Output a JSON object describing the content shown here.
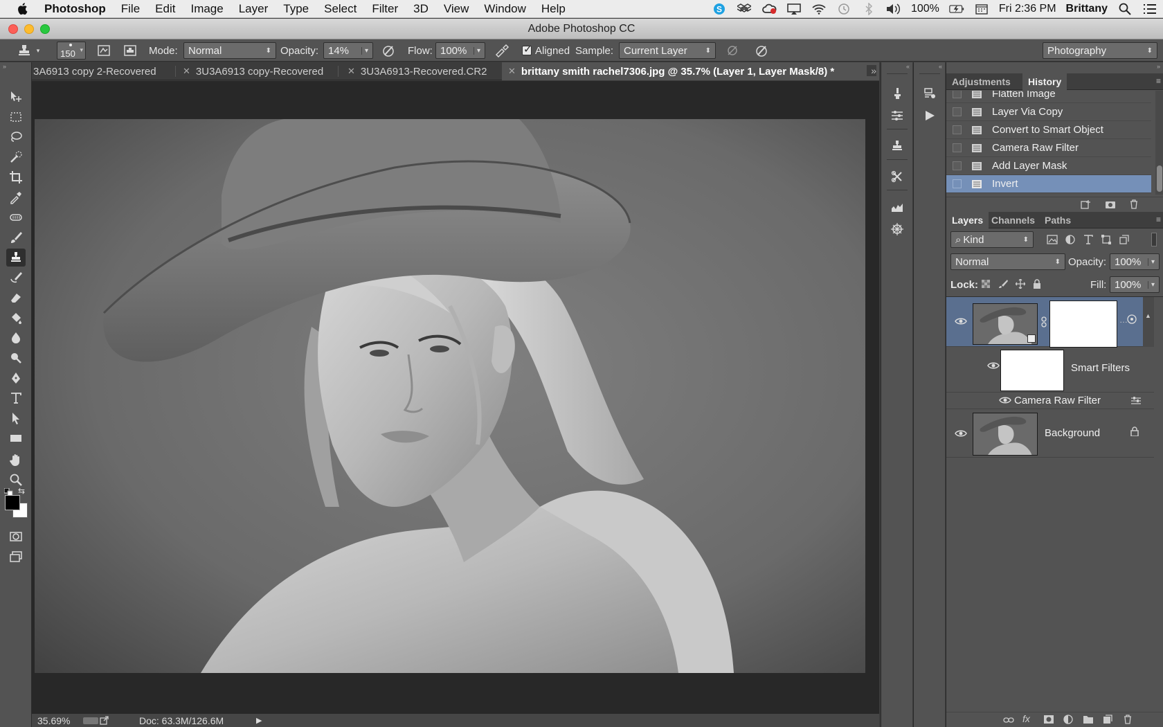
{
  "menubar": {
    "app": "Photoshop",
    "items": [
      "File",
      "Edit",
      "Image",
      "Layer",
      "Type",
      "Select",
      "Filter",
      "3D",
      "View",
      "Window",
      "Help"
    ],
    "battery": "100%",
    "clock": "Fri 2:36 PM",
    "user": "Brittany"
  },
  "window": {
    "title": "Adobe Photoshop CC"
  },
  "options": {
    "brush_size": "150",
    "mode_label": "Mode:",
    "mode_value": "Normal",
    "opacity_label": "Opacity:",
    "opacity_value": "14%",
    "flow_label": "Flow:",
    "flow_value": "100%",
    "aligned_label": "Aligned",
    "sample_label": "Sample:",
    "sample_value": "Current Layer",
    "workspace": "Photography"
  },
  "tabs": [
    {
      "label": "3A6913 copy 2-Recovered"
    },
    {
      "label": "3U3A6913 copy-Recovered"
    },
    {
      "label": "3U3A6913-Recovered.CR2"
    },
    {
      "label": "brittany smith rachel7306.jpg @ 35.7% (Layer 1, Layer Mask/8) *"
    }
  ],
  "status": {
    "zoom": "35.69%",
    "doc": "Doc: 63.3M/126.6M"
  },
  "panels": {
    "top_tabs": [
      "Adjustments",
      "History"
    ],
    "history": [
      "Flatten Image",
      "Layer Via Copy",
      "Convert to Smart Object",
      "Camera Raw Filter",
      "Add Layer Mask",
      "Invert"
    ],
    "layer_tabs": [
      "Layers",
      "Channels",
      "Paths"
    ],
    "kind": "Kind",
    "blend_mode": "Normal",
    "opacity_label": "Opacity:",
    "opacity_value": "100%",
    "lock_label": "Lock:",
    "fill_label": "Fill:",
    "fill_value": "100%",
    "layers": {
      "smart_filters": "Smart Filters",
      "camera_raw": "Camera Raw Filter",
      "background": "Background"
    }
  },
  "colors": {
    "accent_selection": "#7590b8",
    "panel_bg": "#535353",
    "canvas_bg": "#282828"
  }
}
